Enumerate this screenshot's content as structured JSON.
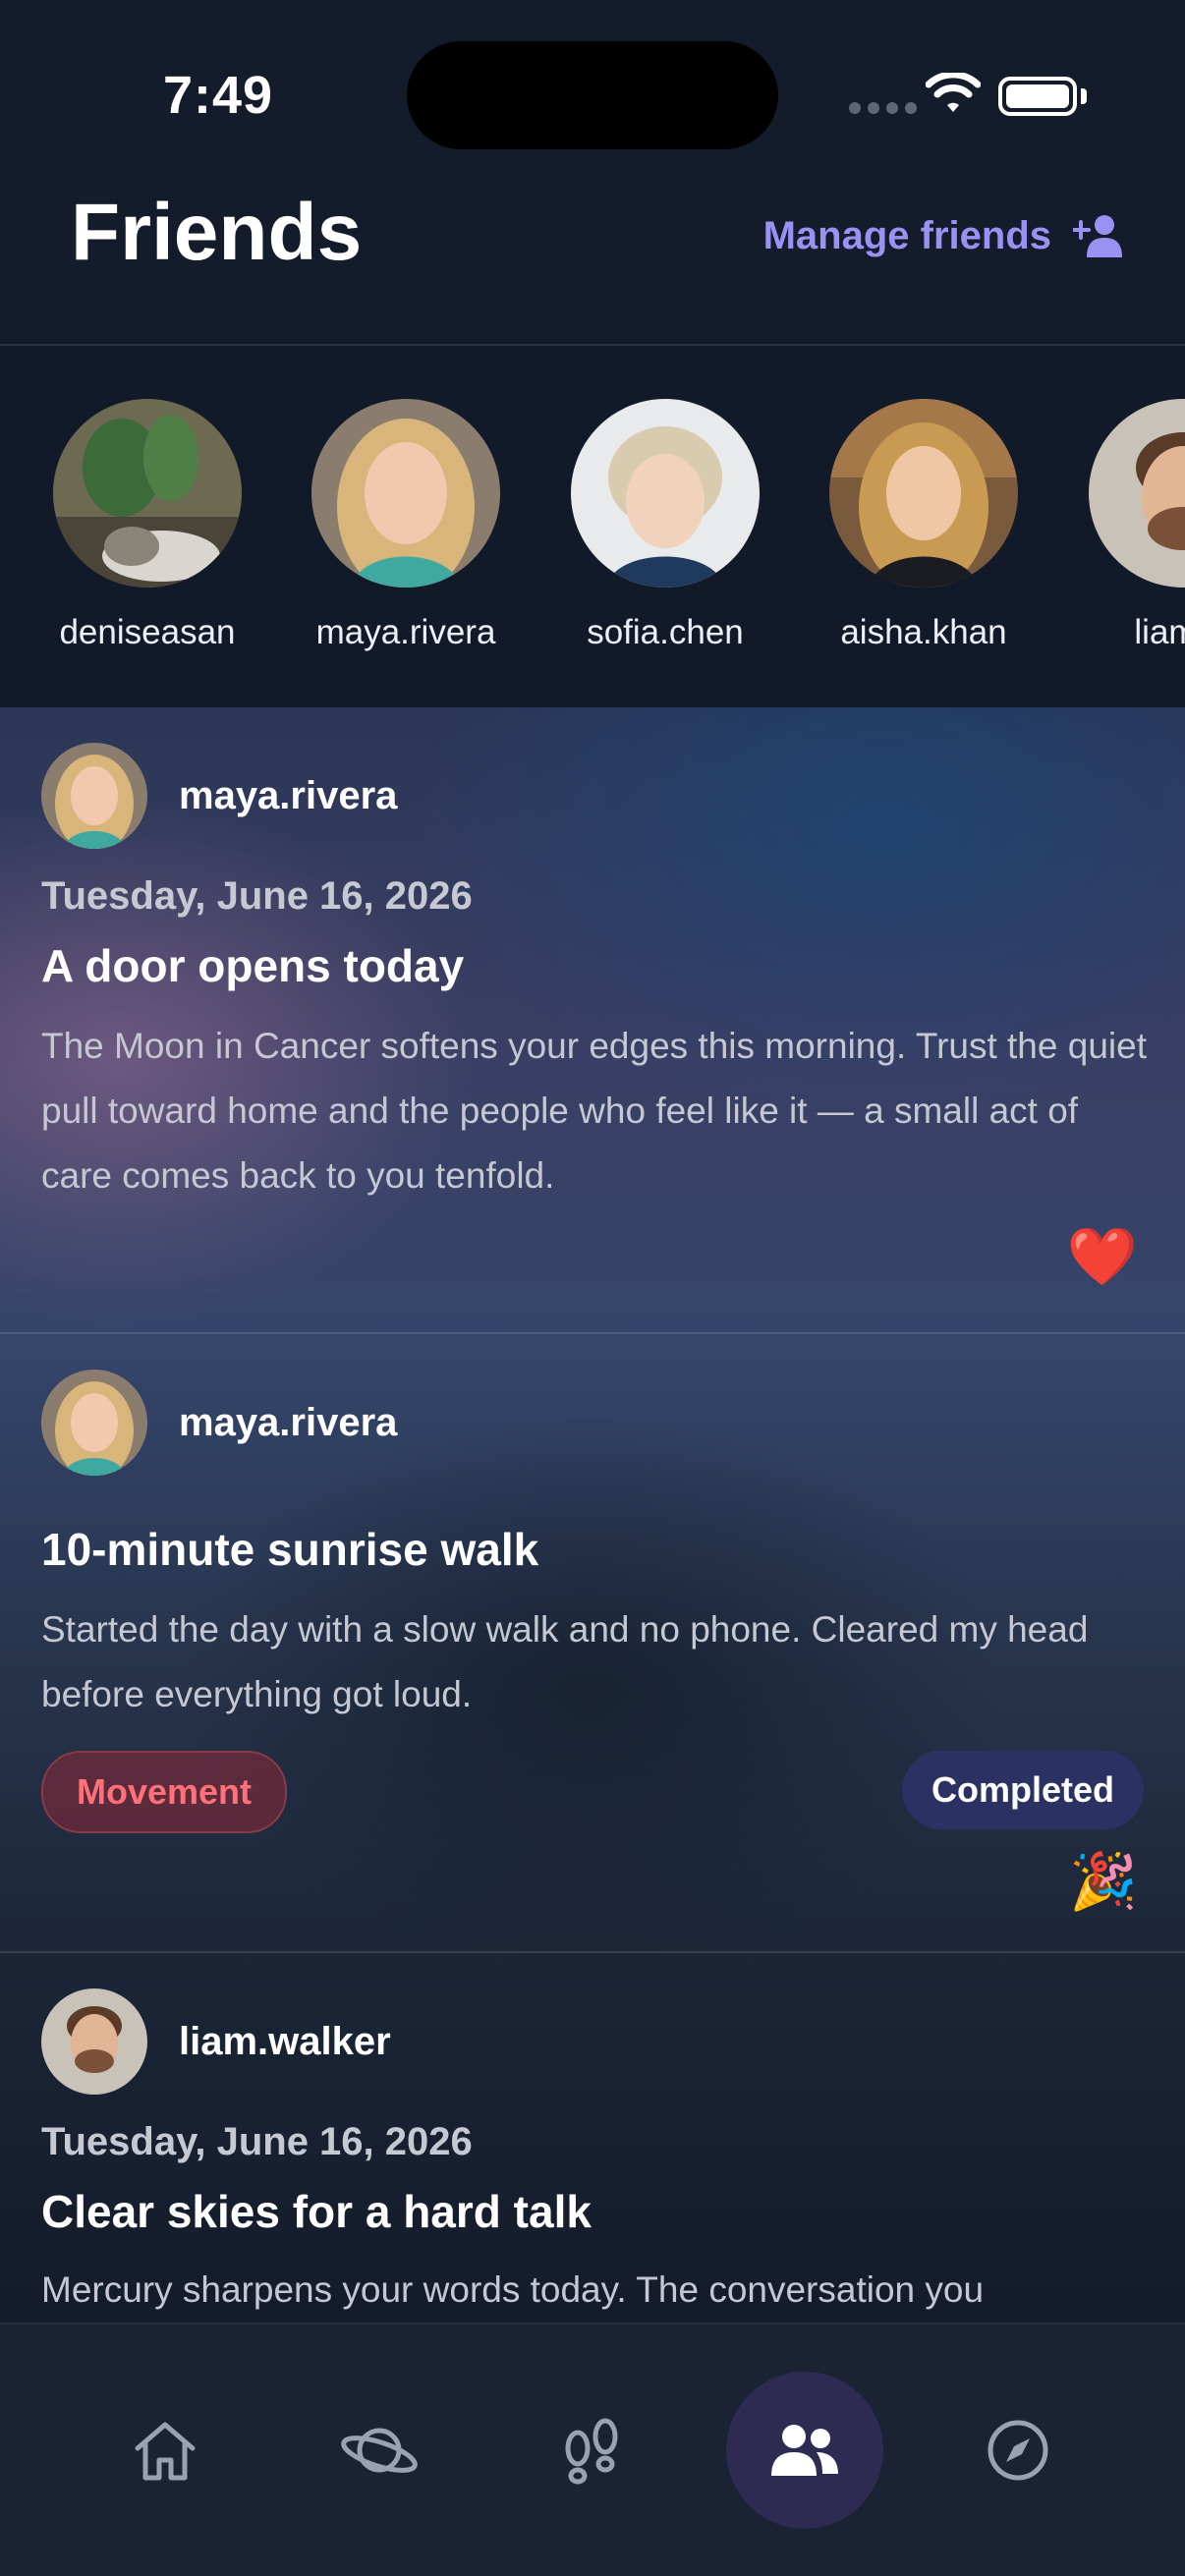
{
  "status_bar": {
    "time": "7:49"
  },
  "header": {
    "title": "Friends",
    "manage_label": "Manage friends"
  },
  "stories": [
    {
      "username": "deniseasan"
    },
    {
      "username": "maya.rivera"
    },
    {
      "username": "sofia.chen"
    },
    {
      "username": "aisha.khan"
    },
    {
      "username": "liam.w"
    }
  ],
  "posts": [
    {
      "username": "maya.rivera",
      "date": "Tuesday, June 16, 2026",
      "title": "A door opens today",
      "body": "The Moon in Cancer softens your edges this morning. Trust the quiet pull toward home and the people who feel like it — a small act of care comes back to you tenfold.",
      "reaction": "❤️"
    },
    {
      "username": "maya.rivera",
      "title": "10-minute sunrise walk",
      "body": "Started the day with a slow walk and no phone. Cleared my head before everything got loud.",
      "tag": "Movement",
      "status": "Completed",
      "reaction": "🎉"
    },
    {
      "username": "liam.walker",
      "date": "Tuesday, June 16, 2026",
      "title": "Clear skies for a hard talk",
      "body": "Mercury sharpens your words today. The conversation you"
    }
  ],
  "tabbar": {
    "items": [
      "home",
      "planet",
      "footsteps",
      "friends",
      "explore"
    ],
    "active": "friends"
  },
  "colors": {
    "accent": "#9a91f3",
    "tag_text": "#ff7079",
    "background": "#141b2b"
  }
}
